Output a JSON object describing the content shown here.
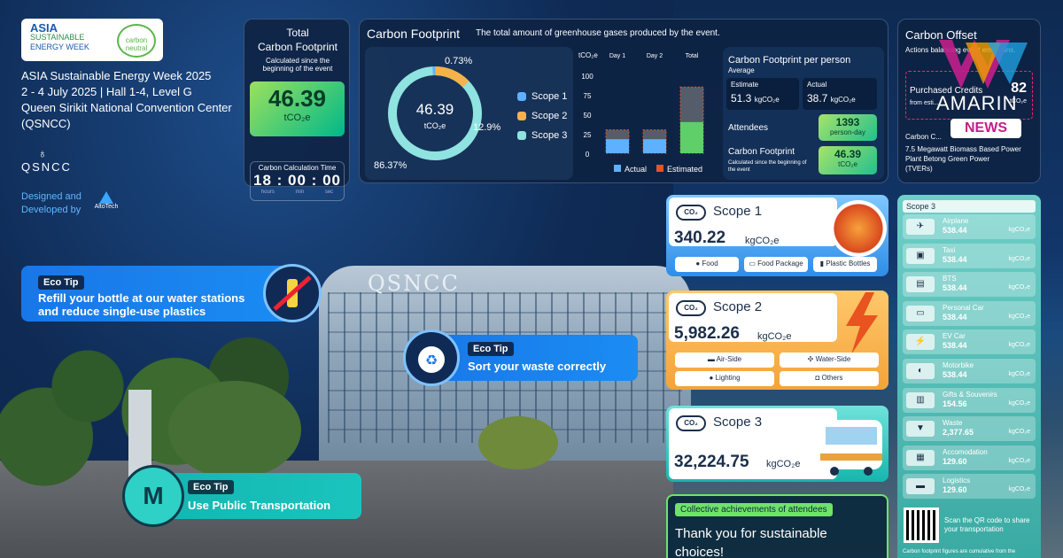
{
  "event": {
    "logo_line1": "ASIA",
    "logo_line2": "SUSTAINABLE",
    "logo_line3": "ENERGY WEEK",
    "logo_badge": "carbon neutral",
    "name": "ASIA Sustainable Energy Week 2025",
    "dates": "2 - 4 July 2025 | Hall 1-4, Level G",
    "venue": "Queen Sirikit National Convention Center",
    "venue_short": "(QSNCC)",
    "venue_mark": "QSNCC",
    "designed_by": "Designed and",
    "developed_by": "Developed by",
    "developer": "AltoTech"
  },
  "total": {
    "title_1": "Total",
    "title_2": "Carbon Footprint",
    "sub": "Calculated since the beginning of the event",
    "value": "46.39",
    "unit": "tCO₂e",
    "timer_label": "Carbon Calculation Time",
    "hours": "18",
    "minutes": "00",
    "seconds": "00",
    "hours_label": "hours",
    "min_label": "min",
    "sec_label": "sec"
  },
  "footprint": {
    "title": "Carbon Footprint",
    "subtitle": "The total amount of greenhouse gases produced by the event.",
    "donut_value": "46.39",
    "donut_unit": "tCO₂e",
    "pct_scope1": "0.73%",
    "pct_scope2": "12.9%",
    "pct_scope3": "86.37%",
    "legend": [
      "Scope 1",
      "Scope 2",
      "Scope 3"
    ],
    "colors": {
      "scope1": "#5fb0ff",
      "scope2": "#f5b24a",
      "scope3": "#8fe3e0"
    },
    "bar_unit": "tCO₂e",
    "bar_cols": [
      "Day 1",
      "Day 2",
      "Total"
    ],
    "bar_ticks": [
      "100",
      "75",
      "50",
      "25",
      "0"
    ],
    "bar_legend_actual": "Actual",
    "bar_legend_estimated": "Estimated"
  },
  "chart_data": {
    "type": "bar",
    "categories": [
      "Day 1",
      "Day 2",
      "Total"
    ],
    "series": [
      {
        "name": "Actual",
        "values": [
          18,
          18,
          40
        ]
      },
      {
        "name": "Estimated",
        "values": [
          30,
          30,
          85
        ]
      }
    ],
    "ylim": [
      0,
      100
    ]
  },
  "per_person": {
    "title": "Carbon Footprint per person",
    "average": "Average",
    "estimate_label": "Estimate",
    "estimate_value": "51.3",
    "actual_label": "Actual",
    "actual_value": "38.7",
    "unit": "kgCO₂e",
    "attendees_label": "Attendees",
    "attendees_value": "1393",
    "attendees_unit": "person-day",
    "cf_label": "Carbon Footprint",
    "cf_sub": "Calculated since the beginning of the event",
    "cf_value": "46.39",
    "cf_unit": "tCO₂e"
  },
  "offset": {
    "title": "Carbon Offset",
    "sub": "Actions balancing event emissions.",
    "credits_label": "Purchased Credits",
    "credits_sub": "from esti...",
    "credits_value": "82",
    "credits_unit": "tCO₂e",
    "project_label": "Carbon C...",
    "project_desc": "7.5 Megawatt Biomass Based Power Plant Betong Green Power",
    "project_type": "(TVERs)",
    "overlay_brand": "AMARIN",
    "overlay_news": "NEWS"
  },
  "eco_tips": [
    {
      "tag": "Eco Tip",
      "text": "Refill your bottle at our water stations and reduce single-use plastics"
    },
    {
      "tag": "Eco Tip",
      "text": "Sort your waste correctly"
    },
    {
      "tag": "Eco Tip",
      "text": "Use Public Transportation",
      "badge": "M"
    }
  ],
  "scope1": {
    "name": "Scope 1",
    "value": "340.22",
    "unit": "kgCO₂e",
    "chips": [
      "Food",
      "Food Package",
      "Plastic Bottles"
    ]
  },
  "scope2": {
    "name": "Scope 2",
    "value": "5,982.26",
    "unit": "kgCO₂e",
    "chips": [
      "Air-Side",
      "Water-Side",
      "Lighting",
      "Others"
    ]
  },
  "scope3": {
    "name": "Scope 3",
    "value": "32,224.75",
    "unit": "kgCO₂e"
  },
  "co2_icon": "CO₂",
  "achievement": {
    "tag": "Collective achievements of attendees",
    "text": "Thank you for sustainable choices!"
  },
  "scope3_list": {
    "title": "Scope 3",
    "items": [
      {
        "name": "Airplane",
        "value": "538.44",
        "unit": "kgCO₂e",
        "icon": "airplane-icon"
      },
      {
        "name": "Taxi",
        "value": "538.44",
        "unit": "kgCO₂e",
        "icon": "taxi-icon"
      },
      {
        "name": "BTS",
        "value": "538.44",
        "unit": "kgCO₂e",
        "icon": "train-icon"
      },
      {
        "name": "Personal Car",
        "value": "538.44",
        "unit": "kgCO₂e",
        "icon": "car-icon"
      },
      {
        "name": "EV Car",
        "value": "538.44",
        "unit": "kgCO₂e",
        "icon": "ev-car-icon"
      },
      {
        "name": "Motorbike",
        "value": "538.44",
        "unit": "kgCO₂e",
        "icon": "motorbike-icon"
      },
      {
        "name": "Gifts & Souvenirs",
        "value": "154.56",
        "unit": "kgCO₂e",
        "icon": "gift-icon"
      },
      {
        "name": "Waste",
        "value": "2,377.65",
        "unit": "kgCO₂e",
        "icon": "waste-bin-icon"
      },
      {
        "name": "Accomodation",
        "value": "129.60",
        "unit": "kgCO₂e",
        "icon": "hotel-icon"
      },
      {
        "name": "Logistics",
        "value": "129.60",
        "unit": "kgCO₂e",
        "icon": "truck-icon"
      }
    ],
    "qr_text": "Scan the QR code to share your transportation",
    "footnote": "Carbon footprint figures are cumulative from the"
  }
}
